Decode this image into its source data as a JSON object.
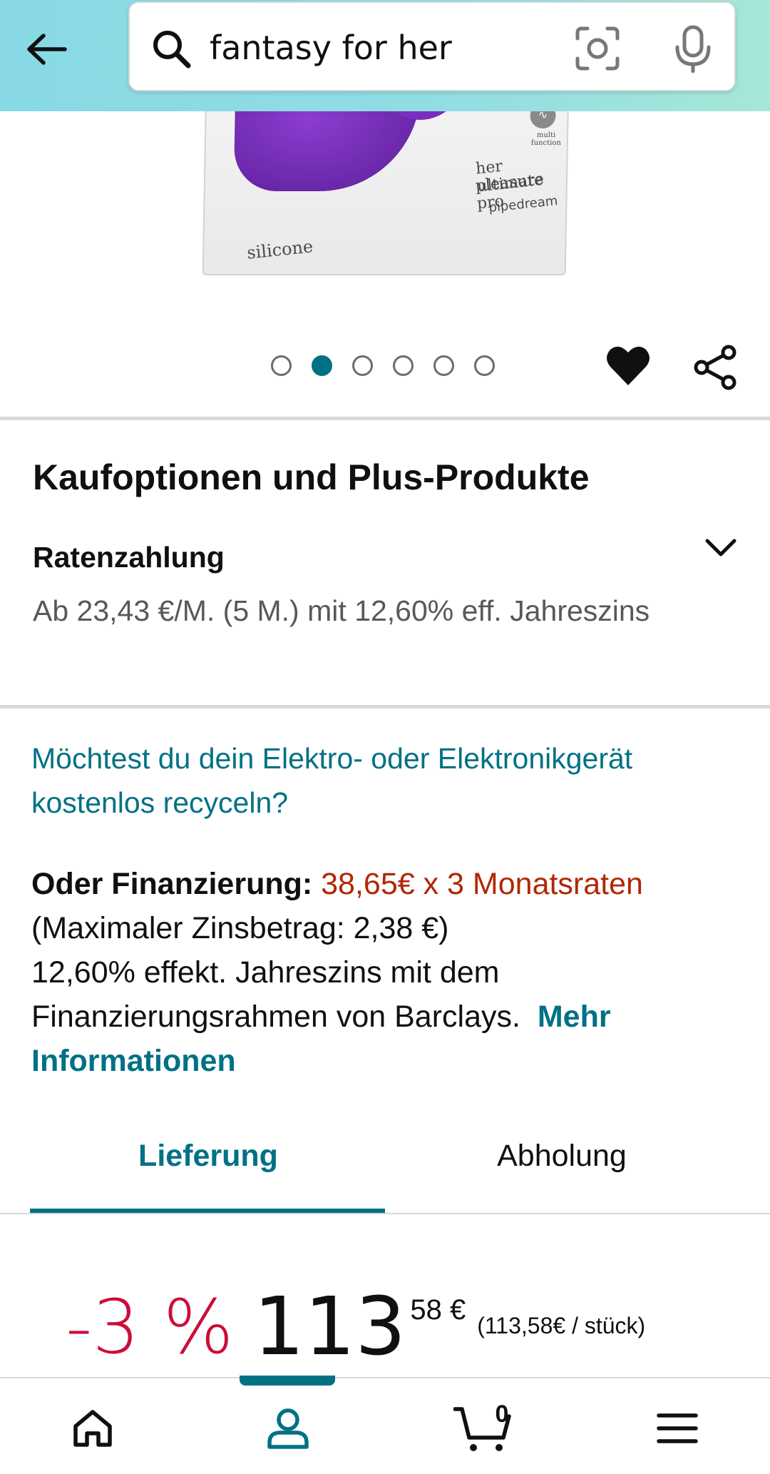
{
  "search": {
    "query": "fantasy for her"
  },
  "product_image": {
    "box_text_line1": "her ultimate",
    "box_text_line2": "pleasure pro",
    "brand": "pipedream",
    "material": "silicone",
    "feature_label": "multi function"
  },
  "carousel": {
    "count": 6,
    "active_index": 1
  },
  "buy_options": {
    "title": "Kaufoptionen und Plus-Produkte",
    "installment_title": "Ratenzahlung",
    "installment_text": "Ab 23,43 €/M. (5 M.) mit 12,60% eff. Jahreszins"
  },
  "recycle": {
    "link_text": "Möchtest du dein Elektro- oder Elektronikgerät kostenlos recyceln?"
  },
  "financing": {
    "label": "Oder Finanzierung:",
    "rate": "38,65€ x 3 Monatsraten",
    "max_interest": "(Maximaler Zinsbetrag: 2,38 €)",
    "details": "12,60% effekt. Jahreszins mit dem Finanzierungsrahmen von Barclays.",
    "more_link": "Mehr Informationen"
  },
  "delivery_tabs": {
    "delivery": "Lieferung",
    "pickup": "Abholung",
    "active": "delivery"
  },
  "price": {
    "discount": "-3 %",
    "whole": "113",
    "fraction": "58 €",
    "unit_price": "(113,58€ / stück)"
  },
  "bottom_nav": {
    "cart_count": "0",
    "active": "account"
  },
  "colors": {
    "accent_teal": "#007185",
    "discount_red": "#cc0c39",
    "rate_orange": "#b12704",
    "header_gradient_start": "#88d9e5",
    "header_gradient_end": "#a6e7d7"
  }
}
